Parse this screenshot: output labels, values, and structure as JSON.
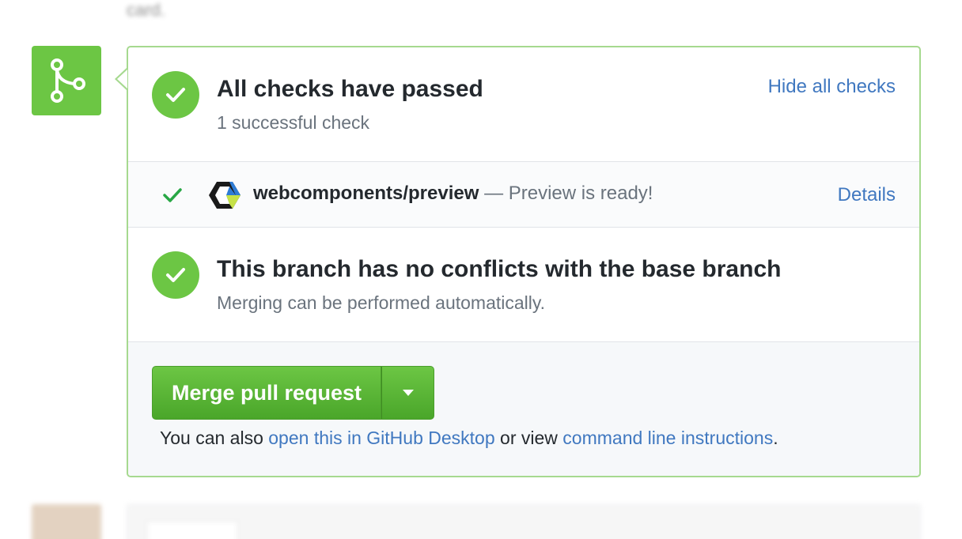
{
  "top_text": "card.",
  "checks": {
    "title": "All checks have passed",
    "subtitle": "1 successful check",
    "hide_link": "Hide all checks"
  },
  "status": {
    "context": "webcomponents/preview",
    "description": "— Preview is ready!",
    "details_link": "Details"
  },
  "branch": {
    "title": "This branch has no conflicts with the base branch",
    "subtitle": "Merging can be performed automatically."
  },
  "merge": {
    "button_label": "Merge pull request",
    "note_prefix": "You can also ",
    "desktop_link": "open this in GitHub Desktop",
    "note_middle": " or view ",
    "cli_link": "command line instructions",
    "note_suffix": "."
  },
  "colors": {
    "success_green": "#6cc644",
    "link_blue": "#4078c0",
    "border_green": "#a6d98f"
  },
  "icons": {
    "merge_box": "git-merge-icon",
    "status": "check-icon",
    "service_logo": "webcomponents-logo-icon",
    "caret": "triangle-down-icon"
  }
}
